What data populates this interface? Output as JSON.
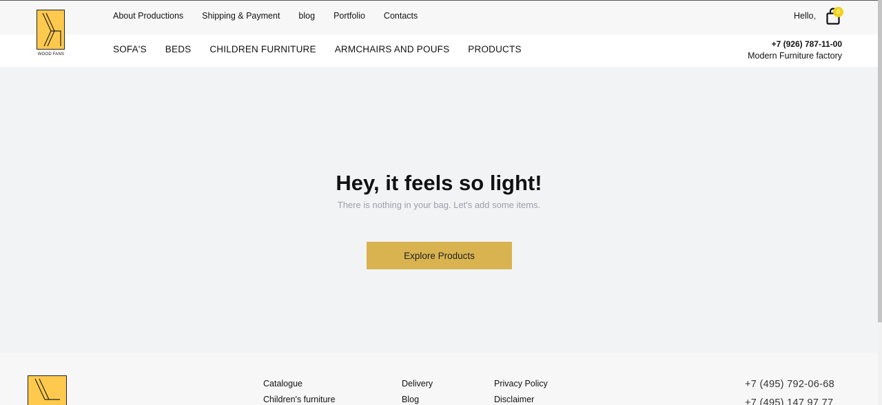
{
  "logo": {
    "text": "WOOD FANS"
  },
  "top_nav": [
    {
      "label": "About Productions"
    },
    {
      "label": "Shipping & Payment"
    },
    {
      "label": "blog"
    },
    {
      "label": "Portfolio"
    },
    {
      "label": "Contacts"
    }
  ],
  "main_nav": [
    {
      "label": "SOFA'S"
    },
    {
      "label": "BEDS"
    },
    {
      "label": "CHILDREN FURNITURE"
    },
    {
      "label": "ARMCHAIRS AND POUFS"
    },
    {
      "label": "PRODUCTS"
    }
  ],
  "user": {
    "greeting": "Hello,"
  },
  "cart": {
    "count": "0",
    "icon": "shopping-bag-icon"
  },
  "contact": {
    "phone": "+7 (926) 787-11-00",
    "tagline": "Modern Furniture factory"
  },
  "empty_bag": {
    "title": "Hey, it feels so light!",
    "subtitle": "There is nothing in your bag. Let's add some items.",
    "button_label": "Explore Products"
  },
  "footer": {
    "col1": [
      "Catalogue",
      "Children's furniture"
    ],
    "col2": [
      "Delivery",
      "Blog"
    ],
    "col3": [
      "Privacy Policy",
      "Disclaimer"
    ],
    "phones": [
      "+7 (495) 792-06-68",
      "+7 (495) 147 97 77"
    ]
  },
  "colors": {
    "accent": "#d8b350",
    "logo_yellow": "#ffc94d",
    "badge": "#f2d21a"
  }
}
